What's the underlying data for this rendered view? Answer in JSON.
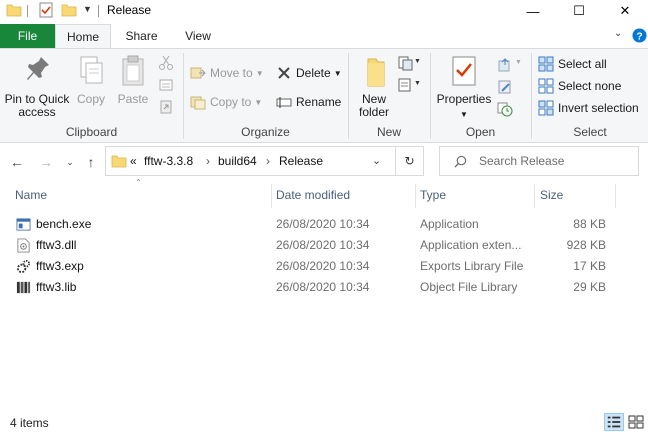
{
  "window": {
    "title": "Release",
    "buttons": {
      "minimize": "—",
      "maximize": "☐",
      "close": "✕"
    }
  },
  "ribbon_tabs": {
    "file": "File",
    "home": "Home",
    "share": "Share",
    "view": "View"
  },
  "ribbon": {
    "clipboard": {
      "label": "Clipboard",
      "pin": "Pin to Quick access",
      "copy": "Copy",
      "paste": "Paste"
    },
    "organize": {
      "label": "Organize",
      "move_to": "Move to",
      "copy_to": "Copy to",
      "delete": "Delete",
      "rename": "Rename"
    },
    "new": {
      "label": "New",
      "new_folder": "New folder"
    },
    "open": {
      "label": "Open",
      "properties": "Properties"
    },
    "select": {
      "label": "Select",
      "select_all": "Select all",
      "select_none": "Select none",
      "invert": "Invert selection"
    }
  },
  "address": {
    "overflow": "«",
    "crumbs": [
      "fftw-3.3.8",
      "build64",
      "Release"
    ],
    "search_placeholder": "Search Release"
  },
  "columns": {
    "name": "Name",
    "date": "Date modified",
    "type": "Type",
    "size": "Size"
  },
  "files": [
    {
      "name": "bench.exe",
      "date": "26/08/2020 10:34",
      "type": "Application",
      "size": "88 KB",
      "icon": "exe-icon"
    },
    {
      "name": "fftw3.dll",
      "date": "26/08/2020 10:34",
      "type": "Application exten...",
      "size": "928 KB",
      "icon": "dll-icon"
    },
    {
      "name": "fftw3.exp",
      "date": "26/08/2020 10:34",
      "type": "Exports Library File",
      "size": "17 KB",
      "icon": "exp-icon"
    },
    {
      "name": "fftw3.lib",
      "date": "26/08/2020 10:34",
      "type": "Object File Library",
      "size": "29 KB",
      "icon": "lib-icon"
    }
  ],
  "status": {
    "item_count": "4 items"
  },
  "colors": {
    "file_tab": "#19873a",
    "ribbon_bg": "#f5f6f7",
    "folder": "#f8d775",
    "accent": "#0078d7"
  }
}
